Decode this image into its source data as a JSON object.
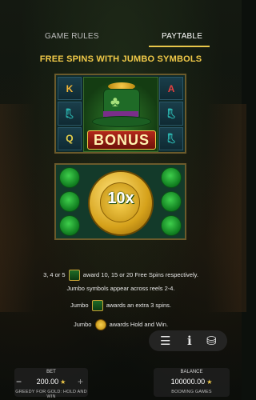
{
  "tabs": {
    "game_rules": "GAME RULES",
    "paytable": "PAYTABLE",
    "active": "paytable"
  },
  "section_title": "FREE SPINS WITH JUMBO SYMBOLS",
  "bonus_panel": {
    "jumbo_symbol_label": "BONUS",
    "left_reel": [
      "K",
      "boot",
      "Q"
    ],
    "right_reel": [
      "A",
      "boot",
      "boot"
    ]
  },
  "coin_panel": {
    "multiplier_label": "10x"
  },
  "rules": {
    "line1_prefix": "3, 4 or 5",
    "line1_suffix": "award 10, 15 or 20 Free Spins respectively.",
    "line2": "Jumbo symbols appear across reels 2-4.",
    "line3_prefix": "Jumbo",
    "line3_suffix": "awards an extra 3 spins.",
    "line4_prefix": "Jumbo",
    "line4_suffix": "awards Hold and Win."
  },
  "controls": {
    "menu_icon": "menu-icon",
    "info_icon": "info-icon",
    "chips_icon": "chips-icon"
  },
  "bet": {
    "label": "BET",
    "value": "200.00",
    "minus": "−",
    "plus": "+",
    "game_name": "GREEDY FOR GOLD: HOLD AND WIN"
  },
  "balance": {
    "label": "BALANCE",
    "value": "100000.00",
    "studio": "BOOMING GAMES"
  },
  "colors": {
    "accent": "#f0c948",
    "panel_border": "#6b5a2b"
  }
}
